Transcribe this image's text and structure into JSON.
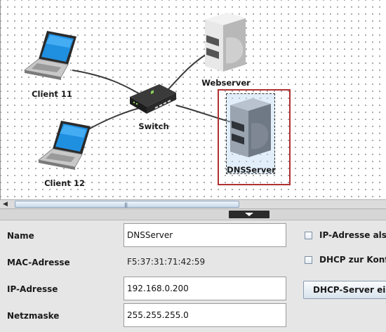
{
  "network": {
    "nodes": {
      "client11": "Client 11",
      "client12": "Client 12",
      "switch": "Switch",
      "webserver": "Webserver",
      "dnsserver": "DNSServer"
    },
    "selected": "DNSServer"
  },
  "properties": {
    "name_label": "Name",
    "name_value": "DNSServer",
    "mac_label": "MAC-Adresse",
    "mac_value": "F5:37:31:71:42:59",
    "ip_label": "IP-Adresse",
    "ip_value": "192.168.0.200",
    "netmask_label": "Netzmaske",
    "netmask_value": "255.255.255.0",
    "ip_as_ns_label": "IP-Adresse als N",
    "dhcp_config_label": "DHCP zur Konfigu",
    "dhcp_server_button": "DHCP-Server einri"
  },
  "colors": {
    "selection": "#b03030",
    "link": "#3a3a3a"
  }
}
